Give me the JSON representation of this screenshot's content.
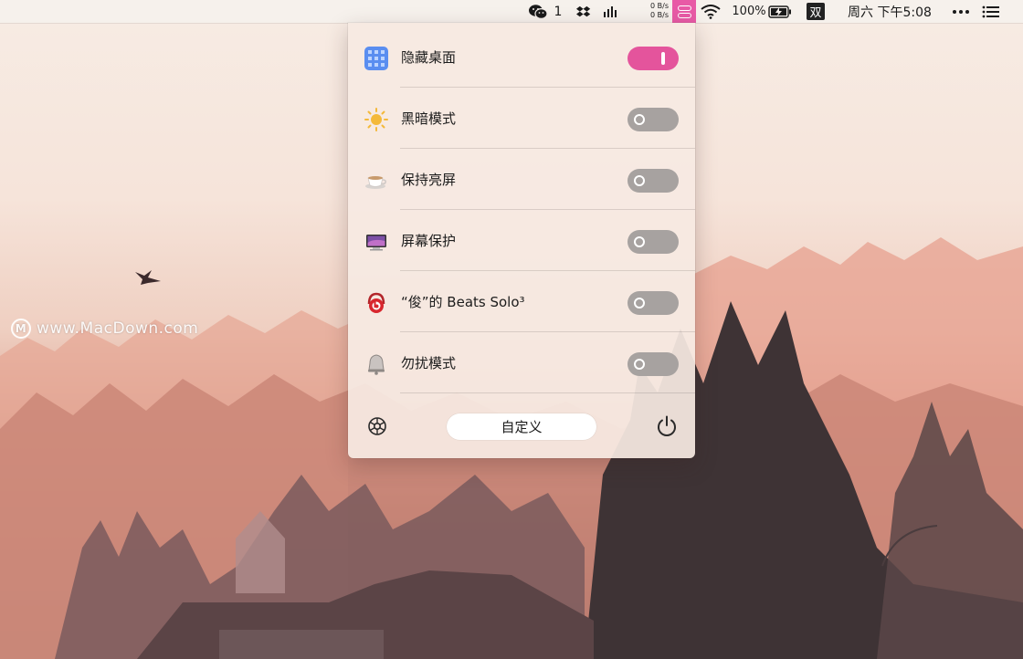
{
  "menubar": {
    "wechat_count": "1",
    "net_up": "0 B/s",
    "net_down": "0 B/s",
    "battery_percent": "100%",
    "input_method": "双",
    "datetime": "周六 下午5:08"
  },
  "watermark": {
    "text": "www.MacDown.com",
    "logo_letter": "M"
  },
  "panel": {
    "rows": [
      {
        "label": "隐藏桌面",
        "on": true,
        "icon": "grid-icon"
      },
      {
        "label": "黑暗模式",
        "on": false,
        "icon": "sun-icon"
      },
      {
        "label": "保持亮屏",
        "on": false,
        "icon": "coffee-cup-icon"
      },
      {
        "label": "屏幕保护",
        "on": false,
        "icon": "display-icon"
      },
      {
        "label": "“俊”的 Beats Solo³",
        "on": false,
        "icon": "beats-headphone-icon"
      },
      {
        "label": "勿扰模式",
        "on": false,
        "icon": "bell-icon"
      }
    ],
    "customize_label": "自定义"
  },
  "colors": {
    "accent": "#e4549c",
    "toggle_off": "#a7a2a0"
  }
}
